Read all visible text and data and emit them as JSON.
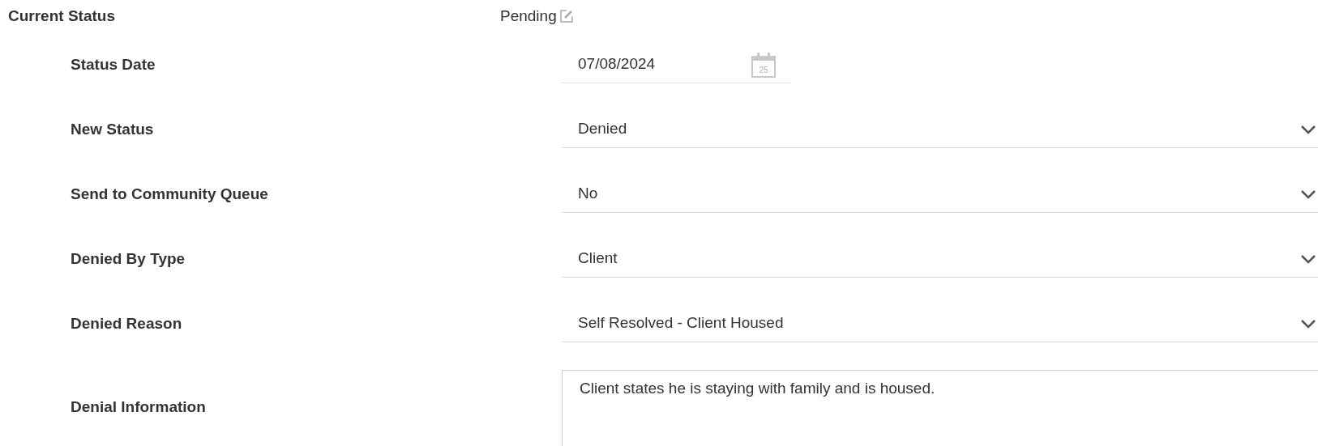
{
  "current_status": {
    "label": "Current Status",
    "value": "Pending"
  },
  "fields": [
    {
      "kind": "date",
      "label": "Status Date",
      "value": "07/08/2024",
      "calendar_day": "25"
    },
    {
      "kind": "select",
      "label": "New Status",
      "value": "Denied"
    },
    {
      "kind": "select",
      "label": "Send to Community Queue",
      "value": "No"
    },
    {
      "kind": "select",
      "label": "Denied By Type",
      "value": "Client"
    },
    {
      "kind": "select",
      "label": "Denied Reason",
      "value": "Self Resolved - Client Housed"
    },
    {
      "kind": "textarea",
      "label": "Denial Information",
      "value": "Client states he is staying with family and is housed."
    }
  ]
}
